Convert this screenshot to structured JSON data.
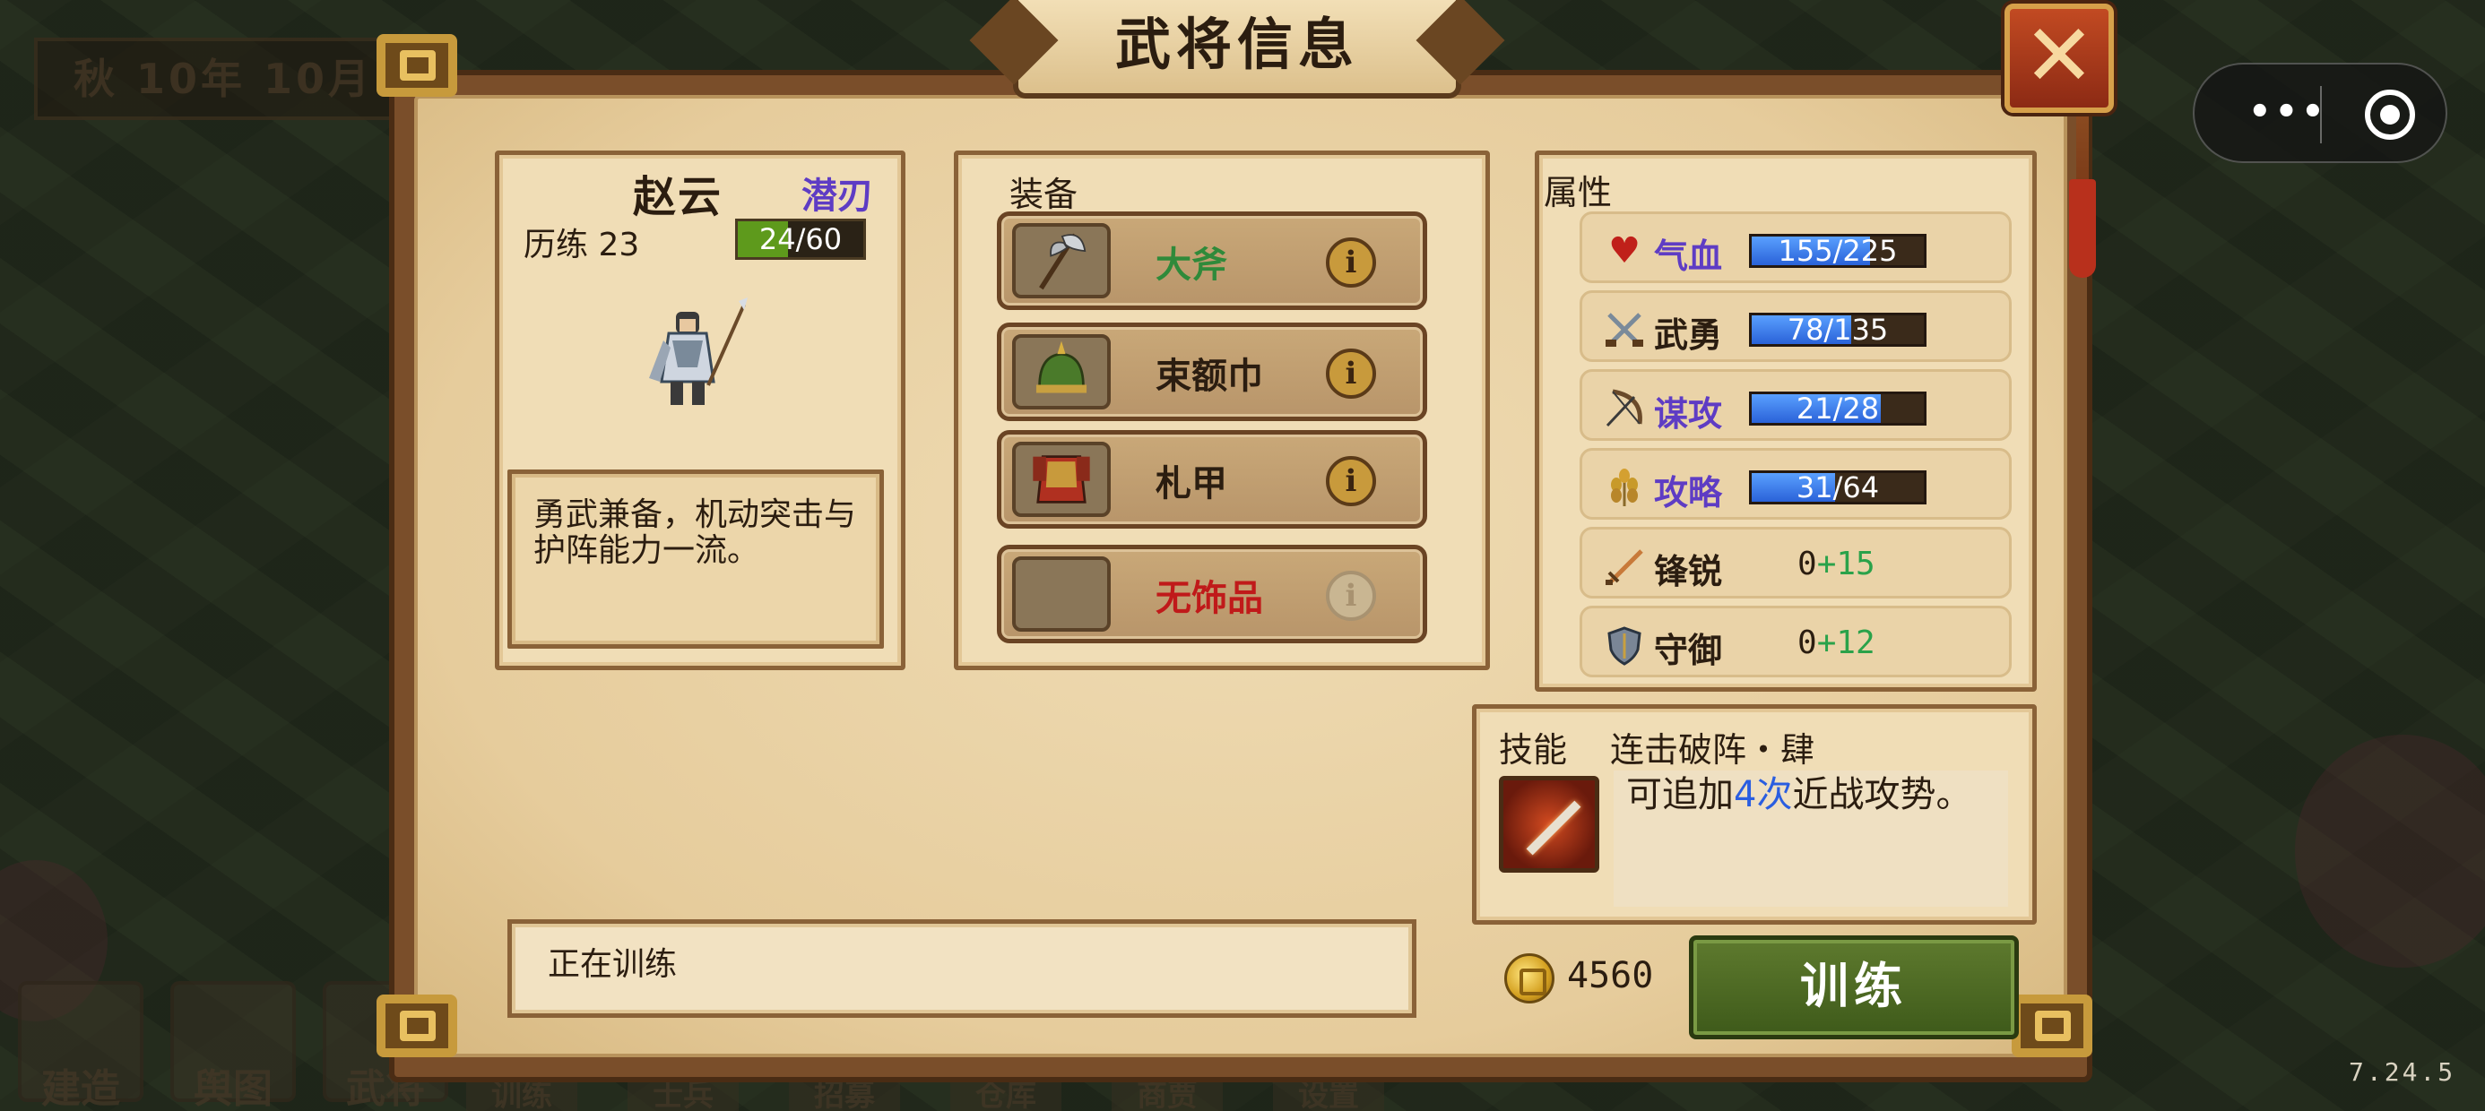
{
  "background": {
    "season": "秋 10年 10月",
    "dock_buttons": [
      "建造",
      "舆图",
      "武将"
    ],
    "dock_tabs": [
      "训练",
      "士兵",
      "招募",
      "仓库",
      "商贾",
      "设置"
    ]
  },
  "header": {
    "title": "武将信息",
    "close_symbol": "✕"
  },
  "capsule": {
    "more": "•••"
  },
  "version": "7.24.5",
  "character": {
    "name": "赵云",
    "trait": "潜刃",
    "experience_label": "历练 23",
    "experience_current": 24,
    "experience_max": 60,
    "experience_text": "24/60",
    "description": "勇武兼备，机动突击与护阵能力一流。"
  },
  "equipment": {
    "title": "装备",
    "slots": [
      {
        "name": "大斧",
        "color": "#2f8a3a",
        "icon": "axe-icon",
        "info": "i"
      },
      {
        "name": "束额巾",
        "color": "#2b1d10",
        "icon": "helmet-icon",
        "info": "i"
      },
      {
        "name": "札甲",
        "color": "#2b1d10",
        "icon": "armor-icon",
        "info": "i"
      },
      {
        "name": "无饰品",
        "color": "#c01a1a",
        "icon": "empty-slot-icon",
        "info": "i"
      }
    ]
  },
  "attributes": {
    "title": "属性",
    "bars": [
      {
        "label": "气血",
        "label_color": "#5e3cc4",
        "icon": "heart-icon",
        "current": 155,
        "max": 225,
        "text": "155/225"
      },
      {
        "label": "武勇",
        "label_color": "#2b1d10",
        "icon": "crossed-swords-icon",
        "current": 78,
        "max": 135,
        "text": "78/135"
      },
      {
        "label": "谋攻",
        "label_color": "#5e3cc4",
        "icon": "bow-icon",
        "current": 21,
        "max": 28,
        "text": "21/28"
      },
      {
        "label": "攻略",
        "label_color": "#5e3cc4",
        "icon": "wheat-icon",
        "current": 31,
        "max": 64,
        "text": "31/64"
      }
    ],
    "stats": [
      {
        "label": "锋锐",
        "icon": "sword-icon",
        "base": "0",
        "bonus": "+15"
      },
      {
        "label": "守御",
        "icon": "shield-icon",
        "base": "0",
        "bonus": "+12"
      }
    ]
  },
  "skill": {
    "label": "技能",
    "name": "连击破阵・肆",
    "desc_prefix": "可追加",
    "desc_highlight": "4次",
    "desc_suffix": "近战攻势。",
    "icon": "blade-skill-icon"
  },
  "training": {
    "status": "正在训练",
    "gold": "4560",
    "button_label": "训练"
  }
}
